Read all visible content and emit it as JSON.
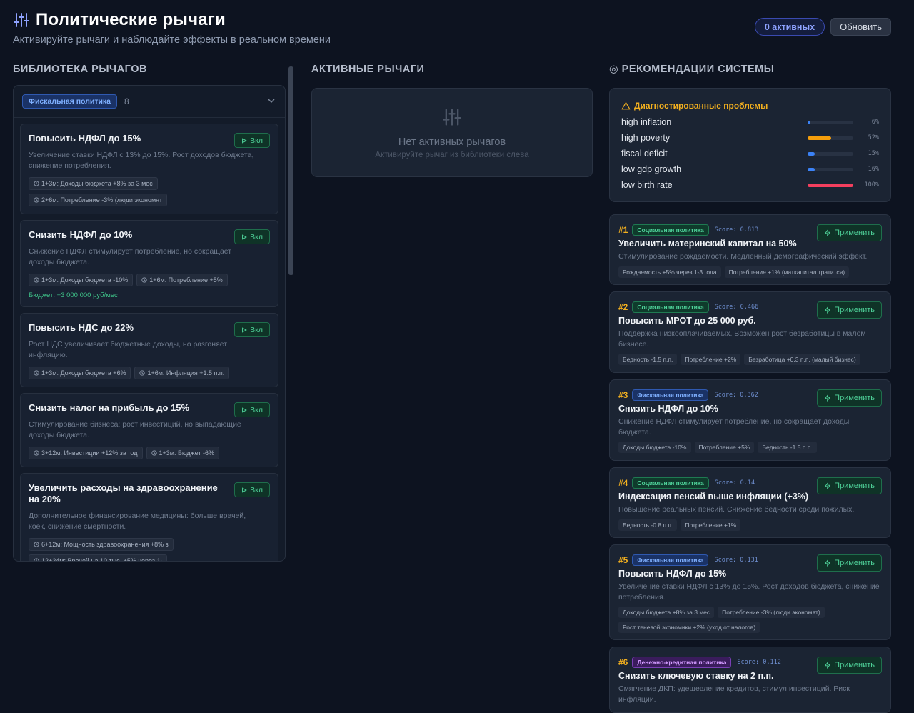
{
  "header": {
    "title": "Политические рычаги",
    "subtitle": "Активируйте рычаги и наблюдайте эффекты в реальном времени",
    "active_pill": "0 активных",
    "refresh_label": "Обновить"
  },
  "library": {
    "section_title": "БИБЛИОТЕКА РЫЧАГОВ",
    "category": "Фискальная политика",
    "count": "8",
    "on_label": "Вкл",
    "levers": [
      {
        "name": "Повысить НДФЛ до 15%",
        "desc": "Увеличение ставки НДФЛ с 13% до 15%. Рост доходов бюджета, снижение потребления.",
        "effects": [
          "1+3м: Доходы бюджета +8% за 3 мес",
          "2+6м: Потребление -3% (люди экономят"
        ],
        "budget": ""
      },
      {
        "name": "Снизить НДФЛ до 10%",
        "desc": "Снижение НДФЛ стимулирует потребление, но сокращает доходы бюджета.",
        "effects": [
          "1+3м: Доходы бюджета -10%",
          "1+6м: Потребление +5%"
        ],
        "budget": "Бюджет: +3 000 000 руб/мес"
      },
      {
        "name": "Повысить НДС до 22%",
        "desc": "Рост НДС увеличивает бюджетные доходы, но разгоняет инфляцию.",
        "effects": [
          "1+3м: Доходы бюджета +6%",
          "1+6м: Инфляция +1.5 п.п."
        ],
        "budget": ""
      },
      {
        "name": "Снизить налог на прибыль до 15%",
        "desc": "Стимулирование бизнеса: рост инвестиций, но выпадающие доходы бюджета.",
        "effects": [
          "3+12м: Инвестиции +12% за год",
          "1+3м: Бюджет -6%"
        ],
        "budget": ""
      },
      {
        "name": "Увеличить расходы на здравоохранение на 20%",
        "desc": "Дополнительное финансирование медицины: больше врачей, коек, снижение смертности.",
        "effects": [
          "6+12м: Мощность здравоохранения +8% з",
          "12+24м: Врачей на 10 тыс. +5% через 1-"
        ],
        "budget": ""
      }
    ]
  },
  "active": {
    "section_title": "АКТИВНЫЕ РЫЧАГИ",
    "empty_title": "Нет активных рычагов",
    "empty_hint": "Активируйте рычаг из библиотеки слева"
  },
  "recs": {
    "section_title": "◎ РЕКОМЕНДАЦИИ СИСТЕМЫ",
    "diag_title": "Диагностированные проблемы",
    "problems": [
      {
        "name": "high inflation",
        "pct": "6%",
        "value": 0.06,
        "color": "#3b82f6"
      },
      {
        "name": "high poverty",
        "pct": "52%",
        "value": 0.52,
        "color": "#f59e0b"
      },
      {
        "name": "fiscal deficit",
        "pct": "15%",
        "value": 0.15,
        "color": "#3b82f6"
      },
      {
        "name": "low gdp growth",
        "pct": "16%",
        "value": 0.16,
        "color": "#3b82f6"
      },
      {
        "name": "low birth rate",
        "pct": "100%",
        "value": 1.0,
        "color": "#f43f5e"
      }
    ],
    "apply_label": "Применить",
    "items": [
      {
        "rank": "#1",
        "cat": "Социальная политика",
        "cat_kind": "social",
        "score": "Score: 0.813",
        "name": "Увеличить материнский капитал на 50%",
        "desc": "Стимулирование рождаемости. Медленный демографический эффект.",
        "chips": [
          "Рождаемость +5% через 1-3 года",
          "Потребление +1% (маткапитал тратится)"
        ]
      },
      {
        "rank": "#2",
        "cat": "Социальная политика",
        "cat_kind": "social",
        "score": "Score: 0.466",
        "name": "Повысить МРОТ до 25 000 руб.",
        "desc": "Поддержка низкооплачиваемых. Возможен рост безработицы в малом бизнесе.",
        "chips": [
          "Бедность -1.5 п.п.",
          "Потребление +2%",
          "Безработица +0.3 п.п. (малый бизнес)"
        ]
      },
      {
        "rank": "#3",
        "cat": "Фискальная политика",
        "cat_kind": "fiscal",
        "score": "Score: 0.362",
        "name": "Снизить НДФЛ до 10%",
        "desc": "Снижение НДФЛ стимулирует потребление, но сокращает доходы бюджета.",
        "chips": [
          "Доходы бюджета -10%",
          "Потребление +5%",
          "Бедность -1.5 п.п."
        ]
      },
      {
        "rank": "#4",
        "cat": "Социальная политика",
        "cat_kind": "social",
        "score": "Score: 0.14",
        "name": "Индексация пенсий выше инфляции (+3%)",
        "desc": "Повышение реальных пенсий. Снижение бедности среди пожилых.",
        "chips": [
          "Бедность -0.8 п.п.",
          "Потребление +1%"
        ]
      },
      {
        "rank": "#5",
        "cat": "Фискальная политика",
        "cat_kind": "fiscal",
        "score": "Score: 0.131",
        "name": "Повысить НДФЛ до 15%",
        "desc": "Увеличение ставки НДФЛ с 13% до 15%. Рост доходов бюджета, снижение потребления.",
        "chips": [
          "Доходы бюджета +8% за 3 мес",
          "Потребление -3% (люди экономят)",
          "Рост теневой экономики +2% (уход от налогов)"
        ]
      },
      {
        "rank": "#6",
        "cat": "Денежно-кредитная политика",
        "cat_kind": "monetary",
        "score": "Score: 0.112",
        "name": "Снизить ключевую ставку на 2 п.п.",
        "desc": "Смягчение ДКП: удешевление кредитов, стимул инвестиций. Риск инфляции.",
        "chips": []
      }
    ]
  }
}
